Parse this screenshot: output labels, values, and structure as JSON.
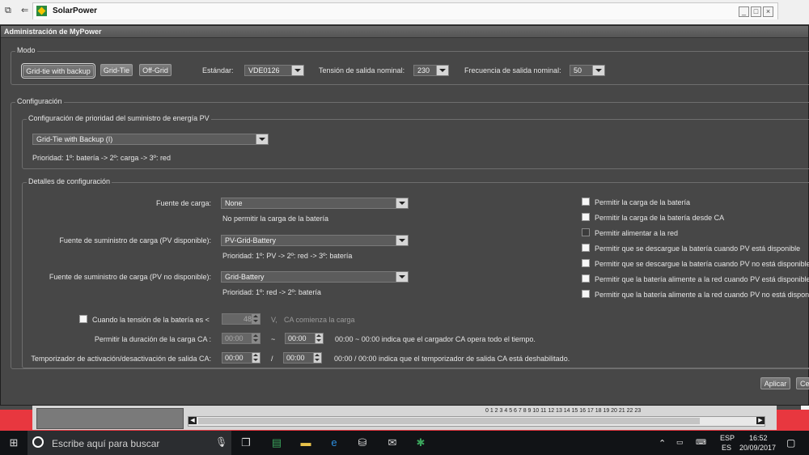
{
  "app": {
    "title": "SolarPower"
  },
  "dialog": {
    "title": "Administración de MyPower"
  },
  "modo": {
    "legend": "Modo",
    "buttons": [
      "Grid-tie with backup",
      "Grid-Tie",
      "Off-Grid"
    ],
    "estandar_label": "Estándar:",
    "estandar_value": "VDE0126",
    "tension_label": "Tensión de salida nominal:",
    "tension_value": "230",
    "frecuencia_label": "Frecuencia de salida nominal:",
    "frecuencia_value": "50"
  },
  "configuracion": {
    "legend": "Configuración",
    "prioridad_legend": "Configuración de prioridad del suministro de energía PV",
    "prioridad_value": "Grid-Tie with Backup (I)",
    "prioridad_desc": "Prioridad: 1º: batería -> 2º: carga -> 3º: red",
    "detalles_legend": "Detalles de configuración",
    "fuente_carga_label": "Fuente de carga:",
    "fuente_carga_value": "None",
    "fuente_carga_desc": "No permitir la carga de la batería",
    "pv_disp_label": "Fuente de suministro de carga (PV disponible):",
    "pv_disp_value": "PV-Grid-Battery",
    "pv_disp_desc": "Prioridad: 1º: PV -> 2º: red -> 3º: batería",
    "pv_nodisp_label": "Fuente de suministro de carga (PV no disponible):",
    "pv_nodisp_value": "Grid-Battery",
    "pv_nodisp_desc": "Prioridad: 1º: red -> 2º: batería",
    "tension_bat_label": "Cuando la tensión de la batería es <",
    "tension_bat_value": "48",
    "tension_bat_unit": "V,",
    "tension_bat_suffix": "CA comienza la carga",
    "duracion_label": "Permitir la duración de la carga CA :",
    "duracion_from": "00:00",
    "duracion_sep": "~",
    "duracion_to": "00:00",
    "duracion_note": "00:00 ~ 00:00 indica que el cargador CA opera todo el tiempo.",
    "temporizador_label": "Temporizador de activación/desactivación de salida CA:",
    "temporizador_from": "00:00",
    "temporizador_sep": "/",
    "temporizador_to": "00:00",
    "temporizador_note": "00:00 / 00:00 indica que el temporizador de salida CA está deshabilitado.",
    "checkboxes": [
      "Permitir la carga de la batería",
      "Permitir la carga de la batería desde CA",
      "Permitir alimentar a la red",
      "Permitir que se descargue la batería cuando PV está disponible",
      "Permitir que se descargue la batería cuando PV no está disponible",
      "Permitir que la batería alimente a la red cuando PV está disponible",
      "Permitir que la batería alimente a la red cuando PV no está disponible"
    ]
  },
  "footer": {
    "apply": "Aplicar",
    "cancel": "Ce"
  },
  "timeline": {
    "ticks": "0  1  2  3  4  5  6  7  8  9  10  11  12  13  14  15  16  17  18  19  20  21  22  23"
  },
  "taskbar": {
    "search_placeholder": "Escribe aquí para buscar",
    "lang_top": "ESP",
    "lang_bottom": "ES",
    "time": "16:52",
    "date": "20/09/2017"
  }
}
